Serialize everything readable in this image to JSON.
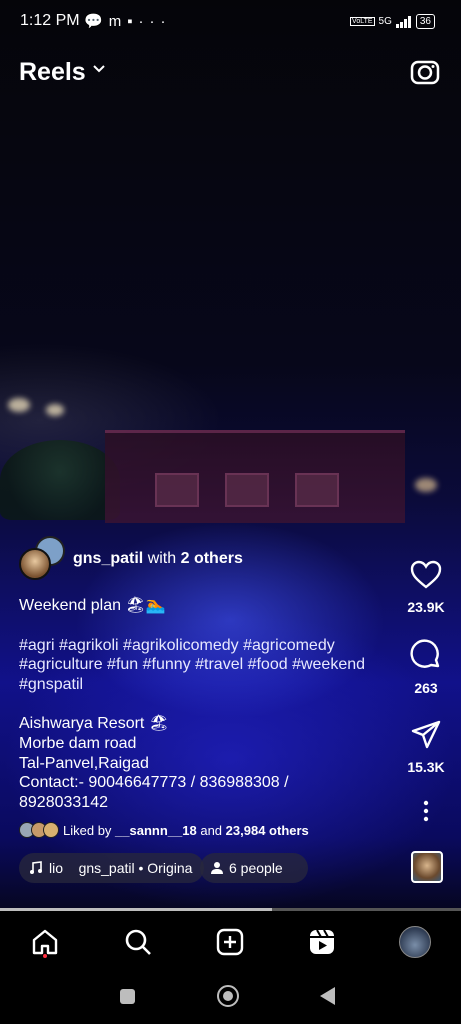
{
  "status_bar": {
    "time": "1:12 PM",
    "icons": [
      "chat-icon",
      "m-icon",
      "notification-icon",
      "more-icon"
    ],
    "network": "5G",
    "lte": "VoLTE",
    "battery": "36"
  },
  "header": {
    "title": "Reels"
  },
  "reel": {
    "author": "gns_patil",
    "with_label": "with",
    "others": "2 others",
    "caption_line": "Weekend plan 🏖🏊",
    "hashtags": "#agri #agrikoli #agrikolicomedy #agricomedy #agriculture #fun #funny #travel #food #weekend #gnspatil",
    "location_lines": [
      "Aishwarya Resort 🏖",
      "Morbe dam road",
      "Tal-Panvel,Raigad",
      "Contact:- 90046647773 / 836988308 /",
      "8928033142"
    ],
    "liked_prefix": "Liked by",
    "liked_user": "__sannn__18",
    "liked_and": "and",
    "liked_others": "23,984 others",
    "audio_label": "lio    gns_patil • Origina",
    "people_label": "6 people",
    "progress": 0.59
  },
  "actions": {
    "likes": "23.9K",
    "comments": "263",
    "shares": "15.3K"
  },
  "colors": {
    "accent_dot": "#ff3040",
    "background": "#000000"
  }
}
